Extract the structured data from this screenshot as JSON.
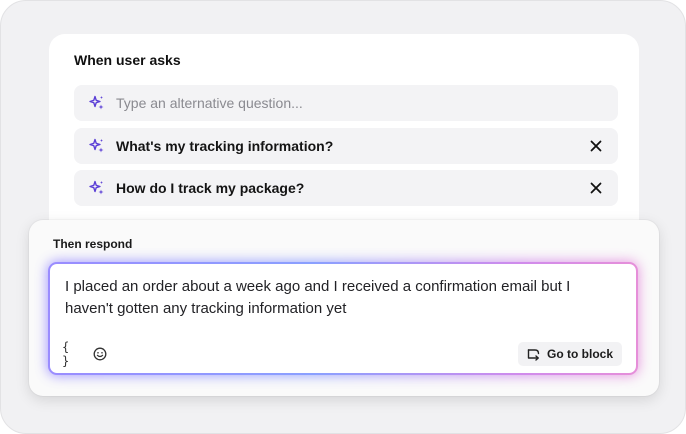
{
  "ask_section": {
    "title": "When user asks",
    "input_placeholder": "Type an alternative question...",
    "questions": [
      {
        "text": "What's my tracking information?"
      },
      {
        "text": "How do I track my package?"
      }
    ]
  },
  "respond_section": {
    "title": "Then respond",
    "response_text": "I placed an order about a week ago and I received a confirmation email but I haven't gotten any tracking information yet",
    "variables_button_label": "{ }",
    "go_to_block_label": "Go to block"
  },
  "icons": {
    "sparkle": "sparkle-icon",
    "remove": "close-icon",
    "emoji": "smiley-icon",
    "go_to_block": "branch-arrow-icon"
  },
  "colors": {
    "accent_purple": "#5b3fd6",
    "glow_start": "#8b7bff",
    "glow_end": "#e27fd7"
  }
}
